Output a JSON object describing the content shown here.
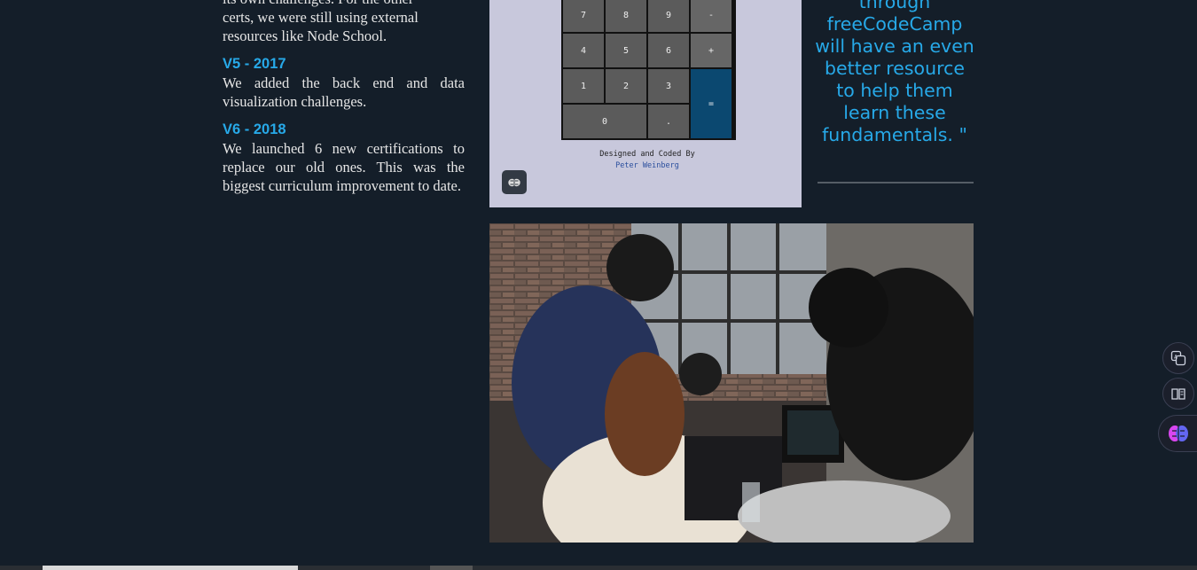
{
  "timeline": {
    "intro_line1": "its own challenges. For the other",
    "intro_line2": "certs, we were still using external",
    "intro_line3": "resources like Node School.",
    "v5_title": "V5 - 2017",
    "v5_text": "We added the back end and data visualization challenges.",
    "v6_title": "V6 - 2018",
    "v6_text": "We launched 6 new certifications to replace our old ones. This was the biggest curriculum improvement to date."
  },
  "calculator": {
    "keys_row1": [
      "7",
      "8",
      "9",
      "-"
    ],
    "keys_row2": [
      "4",
      "5",
      "6",
      "+"
    ],
    "keys_row3": [
      "1",
      "2",
      "3"
    ],
    "key_equals": "=",
    "key_zero": "0",
    "key_dot": ".",
    "credit_label": "Designed and Coded By",
    "credit_author": "Peter Weinberg",
    "icon": "brain-icon"
  },
  "quote": {
    "text": "through freeCodeCamp will have an even better resource to help them learn these fundamentals. \""
  },
  "photo": {
    "alt": "students working at laptops"
  },
  "side_toolbar": {
    "translate_icon": "translate-icon",
    "reader_icon": "reader-icon",
    "ai_icon": "brain-icon"
  },
  "colors": {
    "background": "#141e29",
    "accent": "#27a9e8",
    "calc_panel": "#c8c8dc",
    "equals_key": "#0b4870"
  }
}
